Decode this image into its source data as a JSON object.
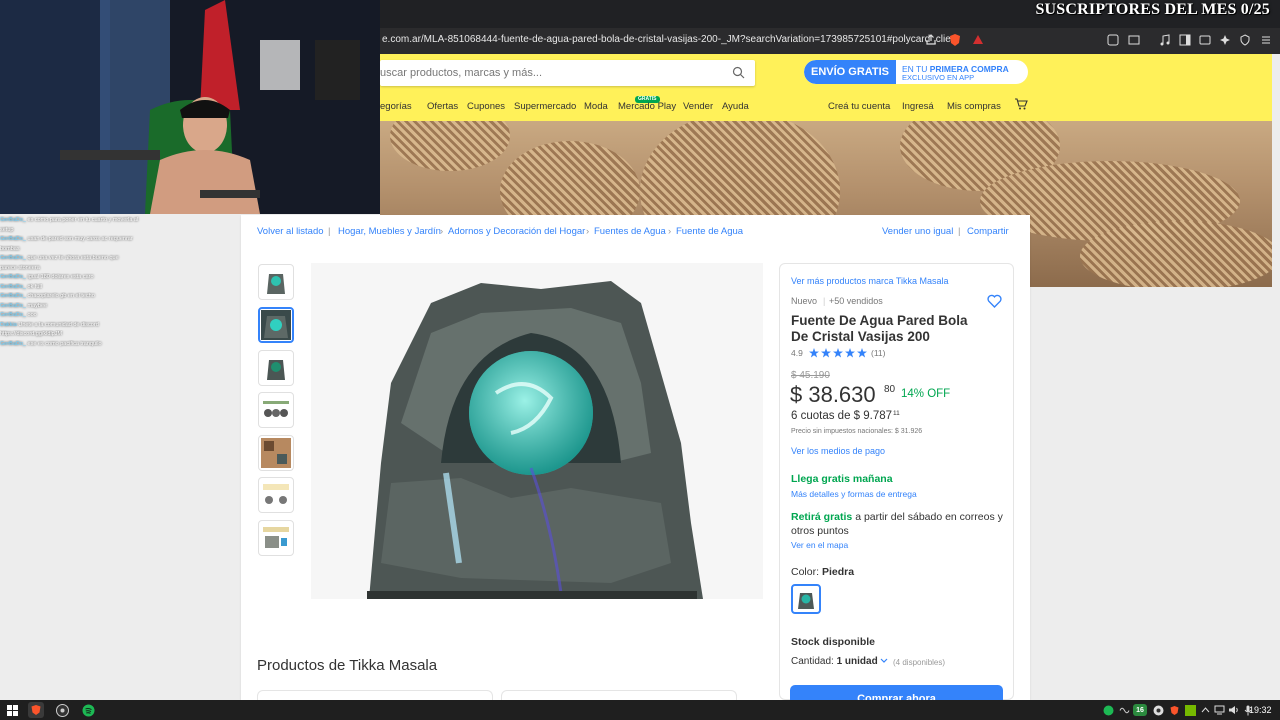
{
  "overlay": {
    "title": "SUSCRIPTORES DEL MES 0/25"
  },
  "browser": {
    "url": "e.com.ar/MLA-851068444-fuente-de-agua-pared-bola-de-cristal-vasijas-200-_JM?searchVariation=173985725101#polycard_clie..."
  },
  "header": {
    "search_placeholder": "uscar productos, marcas y más...",
    "promo_left": "ENVÍO GRATIS",
    "promo_right_1a": "EN TU ",
    "promo_right_1b": "PRIMERA COMPRA",
    "promo_right_2": "EXCLUSIVO EN APP",
    "nav": [
      "egorías",
      "Ofertas",
      "Cupones",
      "Supermercado",
      "Moda",
      "Mercado Play",
      "Vender",
      "Ayuda"
    ],
    "nav_badge": "GRATIS",
    "account": [
      "Creá tu cuenta",
      "Ingresá",
      "Mis compras"
    ]
  },
  "chat": [
    {
      "user": "GerBaDo_",
      "msg": " es como para poner en tu cuarto y moverla al"
    },
    {
      "user": "",
      "msg": "setup"
    },
    {
      "user": "GerBaDo_",
      "msg": " usan de pared son muy caros ac requenrar"
    },
    {
      "user": "",
      "msg": "bombas"
    },
    {
      "user": "GerBaDo_",
      "msg": " que una vez te ahora esta bueno que"
    },
    {
      "user": "",
      "msg": "parece stoneera"
    },
    {
      "user": "GerBaDo_",
      "msg": " igual 180 dolares esta caro"
    },
    {
      "user": "GerBaDo_",
      "msg": " ok full"
    },
    {
      "user": "GerBaDo_",
      "msg": " chacoplarelo gb en el techo"
    },
    {
      "user": "GerBaDo_",
      "msg": " maybee"
    },
    {
      "user": "GerBaDo_",
      "msg": " ooo"
    },
    {
      "user": "Dakkia",
      "msg": " Unete a la comunidad de discord"
    },
    {
      "user": "",
      "msg": "https://discord.gg/kldlpJM"
    },
    {
      "user": "GerBaDo_",
      "msg": " ese es como pacifica tranquilo"
    }
  ],
  "breadcrumb": {
    "back": "Volver al listado",
    "items": [
      "Hogar, Muebles y Jardín",
      "Adornos y Decoración del Hogar",
      "Fuentes de Agua",
      "Fuente de Agua"
    ],
    "sell_same": "Vender uno igual",
    "share": "Compartir"
  },
  "product": {
    "brand_link": "Ver más productos marca Tikka Masala",
    "condition": "Nuevo",
    "sold": "+50 vendidos",
    "title_1": "Fuente De Agua Pared Bola",
    "title_2": "De Cristal Vasijas 200",
    "rating": "4.9",
    "rating_stars": 4.9,
    "reviews": "(11)",
    "old_price": "$ 45.190",
    "price": "$ 38.630",
    "price_cents": "80",
    "discount": "14% OFF",
    "installments": "6 cuotas de $ 9.787",
    "installments_cents": "11",
    "tax_note": "Precio sin impuestos nacionales: $ 31.926",
    "payment_link": "Ver los medios de pago",
    "shipping": "Llega gratis mañana",
    "shipping_link": "Más detalles y formas de entrega",
    "pickup_bold": "Retirá gratis",
    "pickup_1": " a partir del sábado en correos y",
    "pickup_2": "otros puntos",
    "map_link": "Ver en el mapa",
    "color_label": "Color: ",
    "color_value": "Piedra",
    "stock": "Stock disponible",
    "qty_label": "Cantidad: ",
    "qty_value": "1 unidad",
    "qty_available": "(4 disponibles)",
    "buy": "Comprar ahora"
  },
  "section": {
    "title": "Productos de Tikka Masala"
  },
  "taskbar": {
    "time": "19:32",
    "tray_badge": "16"
  },
  "colors": {
    "ml_yellow": "#fff159",
    "ml_blue": "#3483fa",
    "ml_green": "#00a650"
  }
}
